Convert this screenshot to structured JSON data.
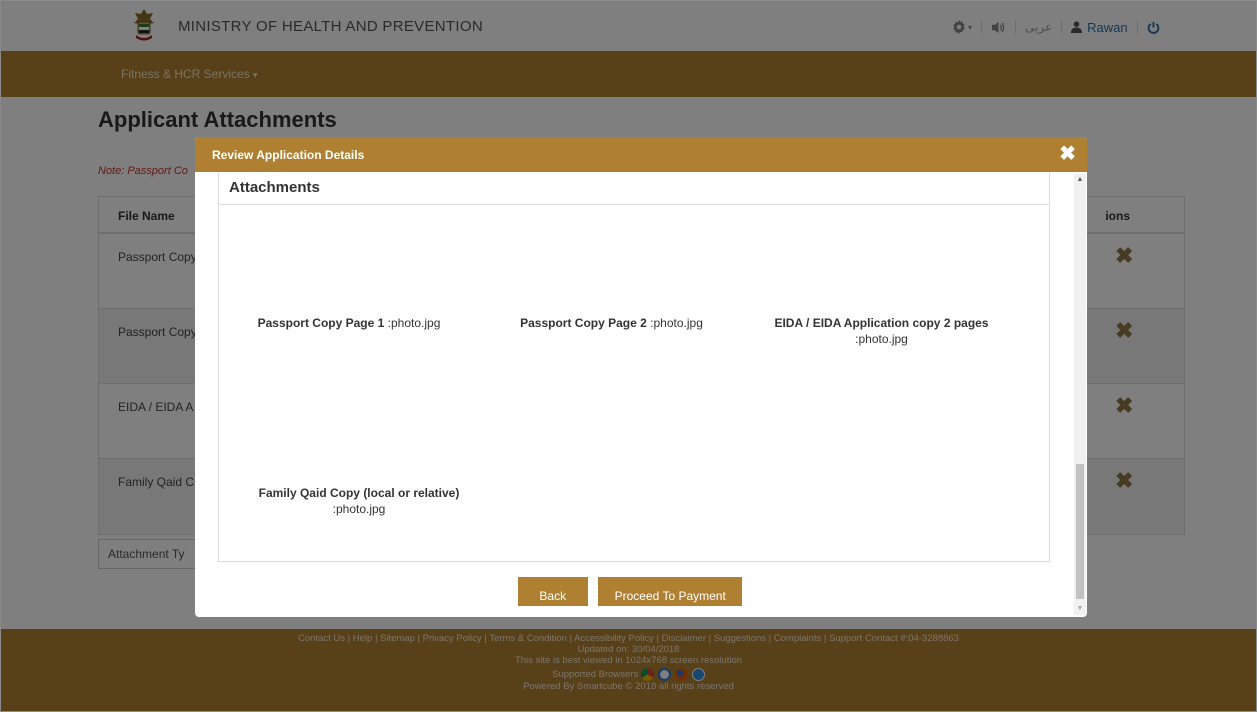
{
  "header": {
    "ministry_name": "MINISTRY OF HEALTH AND PREVENTION",
    "language_link": "عربى",
    "user_name": "Rawan"
  },
  "nav": {
    "menu_label": "Fitness & HCR Services"
  },
  "page": {
    "title": "Applicant Attachments",
    "note": "Note: Passport Co",
    "table": {
      "col_file_name": "File Name",
      "col_actions": "ions",
      "rows": [
        {
          "file_name": "Passport Copy"
        },
        {
          "file_name": "Passport Copy"
        },
        {
          "file_name": "EIDA / EIDA A"
        },
        {
          "file_name": "Family Qaid C"
        }
      ]
    },
    "attachment_type": "Attachment Ty"
  },
  "modal": {
    "title": "Review Application Details",
    "section_heading": "Attachments",
    "attachments": [
      {
        "label": "Passport Copy Page 1",
        "file": ":photo.jpg"
      },
      {
        "label": "Passport Copy Page 2",
        "file": ":photo.jpg"
      },
      {
        "label": "EIDA / EIDA Application copy 2 pages",
        "file": ":photo.jpg"
      },
      {
        "label": "Family Qaid Copy (local or relative)",
        "file": ":photo.jpg"
      }
    ],
    "back_label": "Back",
    "proceed_label": "Proceed To Payment"
  },
  "footer": {
    "links": "Contact Us | Help | Sitemap | Privacy Policy | Terms & Condition | Accessibility Policy | Disclaimer | Suggestions | Complaints |  Support Contact #:04-3288863",
    "updated": "Updated on: 30/04/2018",
    "resolution": "This site is best viewed in 1024x768 screen resolution",
    "browsers_label": "Supported Browsers",
    "powered": "Powered By Smartcube © 2018 all rights reserved"
  },
  "icons": {
    "settings": "gear-icon",
    "audio": "speaker-icon",
    "user": "user-icon",
    "logout": "power-icon",
    "delete": "close-icon"
  },
  "colors": {
    "brand_gold": "#b08032",
    "delete_icon": "#8f7747",
    "note_red": "#c9302c"
  }
}
